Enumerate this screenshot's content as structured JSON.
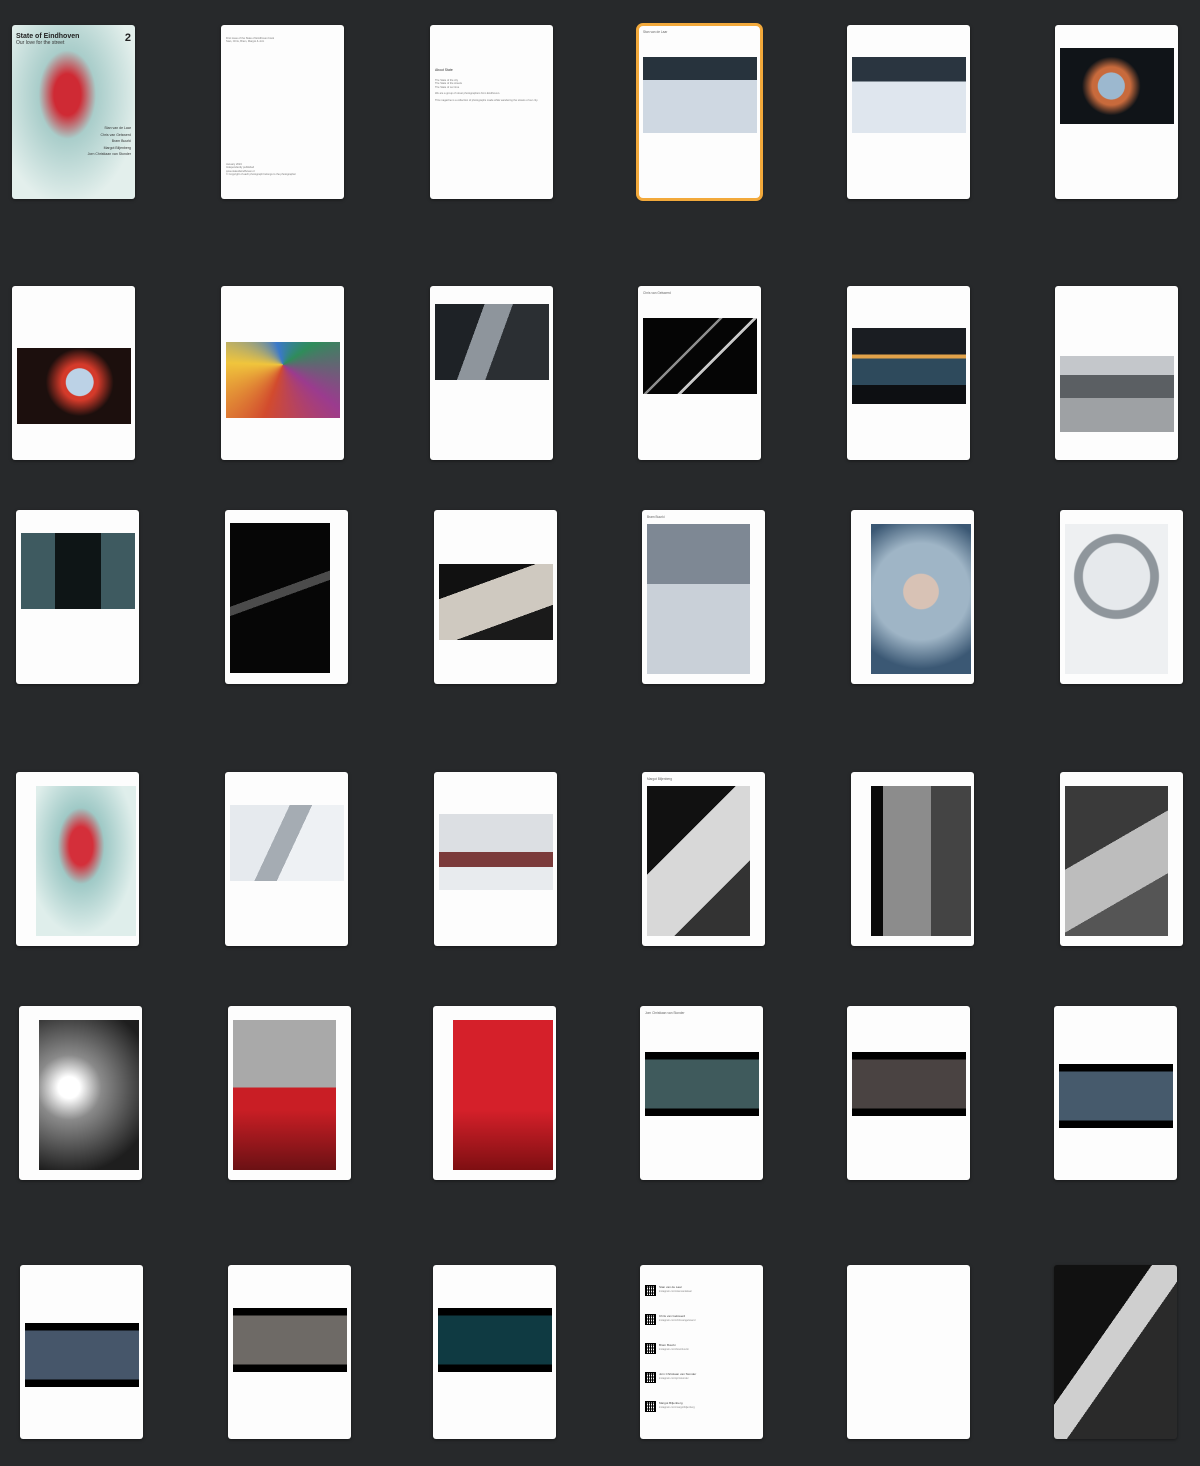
{
  "app": {
    "view": "Page thumbnails"
  },
  "colors": {
    "background": "#27292b",
    "selection": "#f2a93b",
    "page": "#fdfdfd"
  },
  "cover": {
    "title": "State of Eindhoven",
    "subtitle": "Our love for the street",
    "number": "2",
    "names": [
      "Stan van de Laar",
      "Chris van Gelswerd",
      "Bram Buurki",
      "Margot Biljenberg",
      "Jorn Christiaan van Stonder"
    ]
  },
  "colophon": {
    "top": "First issue of the State of Eindhoven book\nStan, Chris, Bram, Margot & Jorn",
    "bottom": "January 2024\nIndependently published\nwww.stateofeindhoven.nl\n© Copyright of each photograph belongs to the photographer"
  },
  "about": {
    "heading": "About State",
    "body": "The State of the city\nThe State of the streets\nThe State of our time\n\nWe are a group of street photographers from Eindhoven.\n\nThis magazine is a collection of photographs made while wandering the streets of our city."
  },
  "headers": {
    "p4": "Stan van de Laar",
    "p10": "Chris van Gelswerd",
    "p16": "Bram Buurki",
    "p22": "Margot Biljenberg",
    "p28": "Jorn Christiaan van Stonder"
  },
  "contacts": [
    {
      "name": "Stan van de Laar",
      "link": "instagram.com/stanvandelaar"
    },
    {
      "name": "Chris van Gelswerd",
      "link": "instagram.com/chrisvangelswerd"
    },
    {
      "name": "Bram Buurki",
      "link": "instagram.com/brambuurki"
    },
    {
      "name": "Jorn Christiaan van Stonder",
      "link": "instagram.com/jornstonder"
    },
    {
      "name": "Margot Biljenberg",
      "link": "instagram.com/margotbiljenberg"
    }
  ],
  "pages": [
    {
      "kind": "cover"
    },
    {
      "kind": "colophon"
    },
    {
      "kind": "about"
    },
    {
      "kind": "photo",
      "img": "snow-park-1",
      "hdr": "p4",
      "selected": true
    },
    {
      "kind": "photo",
      "img": "snow-park-2"
    },
    {
      "kind": "photo",
      "img": "umbrella-night"
    },
    {
      "kind": "photo",
      "img": "umbrella-rain"
    },
    {
      "kind": "photo",
      "img": "umbrellas-color"
    },
    {
      "kind": "photo",
      "img": "people-umbrellas"
    },
    {
      "kind": "photo",
      "img": "architecture-dark",
      "hdr": "p10"
    },
    {
      "kind": "photo",
      "img": "subway-lights"
    },
    {
      "kind": "photo",
      "img": "building-steps"
    },
    {
      "kind": "photo",
      "img": "glass-corridor"
    },
    {
      "kind": "photo",
      "img": "dark-stairs-tall"
    },
    {
      "kind": "photo",
      "img": "escalator"
    },
    {
      "kind": "photo",
      "img": "snow-red-umbrella",
      "hdr": "p16"
    },
    {
      "kind": "photo",
      "img": "frosted-face"
    },
    {
      "kind": "photo",
      "img": "snow-dome"
    },
    {
      "kind": "photo",
      "img": "red-figure-glass"
    },
    {
      "kind": "photo",
      "img": "snow-walkers"
    },
    {
      "kind": "photo",
      "img": "snow-graffiti"
    },
    {
      "kind": "photo",
      "img": "bw-shadows",
      "hdr": "p22"
    },
    {
      "kind": "photo",
      "img": "bw-window-figure"
    },
    {
      "kind": "photo",
      "img": "bw-snow-street"
    },
    {
      "kind": "photo",
      "img": "bw-tower-sun"
    },
    {
      "kind": "photo",
      "img": "rain-window-red"
    },
    {
      "kind": "photo",
      "img": "red-umbrella-glass"
    },
    {
      "kind": "photo",
      "img": "cine-street-1",
      "hdr": "p28"
    },
    {
      "kind": "photo",
      "img": "cine-street-2"
    },
    {
      "kind": "photo",
      "img": "cine-crossing"
    },
    {
      "kind": "photo",
      "img": "cine-car-night"
    },
    {
      "kind": "photo",
      "img": "cine-cyclist"
    },
    {
      "kind": "photo",
      "img": "cine-teal-umbrella"
    },
    {
      "kind": "contacts"
    },
    {
      "kind": "blank"
    },
    {
      "kind": "fullbleed",
      "img": "bw-light-wall"
    }
  ]
}
